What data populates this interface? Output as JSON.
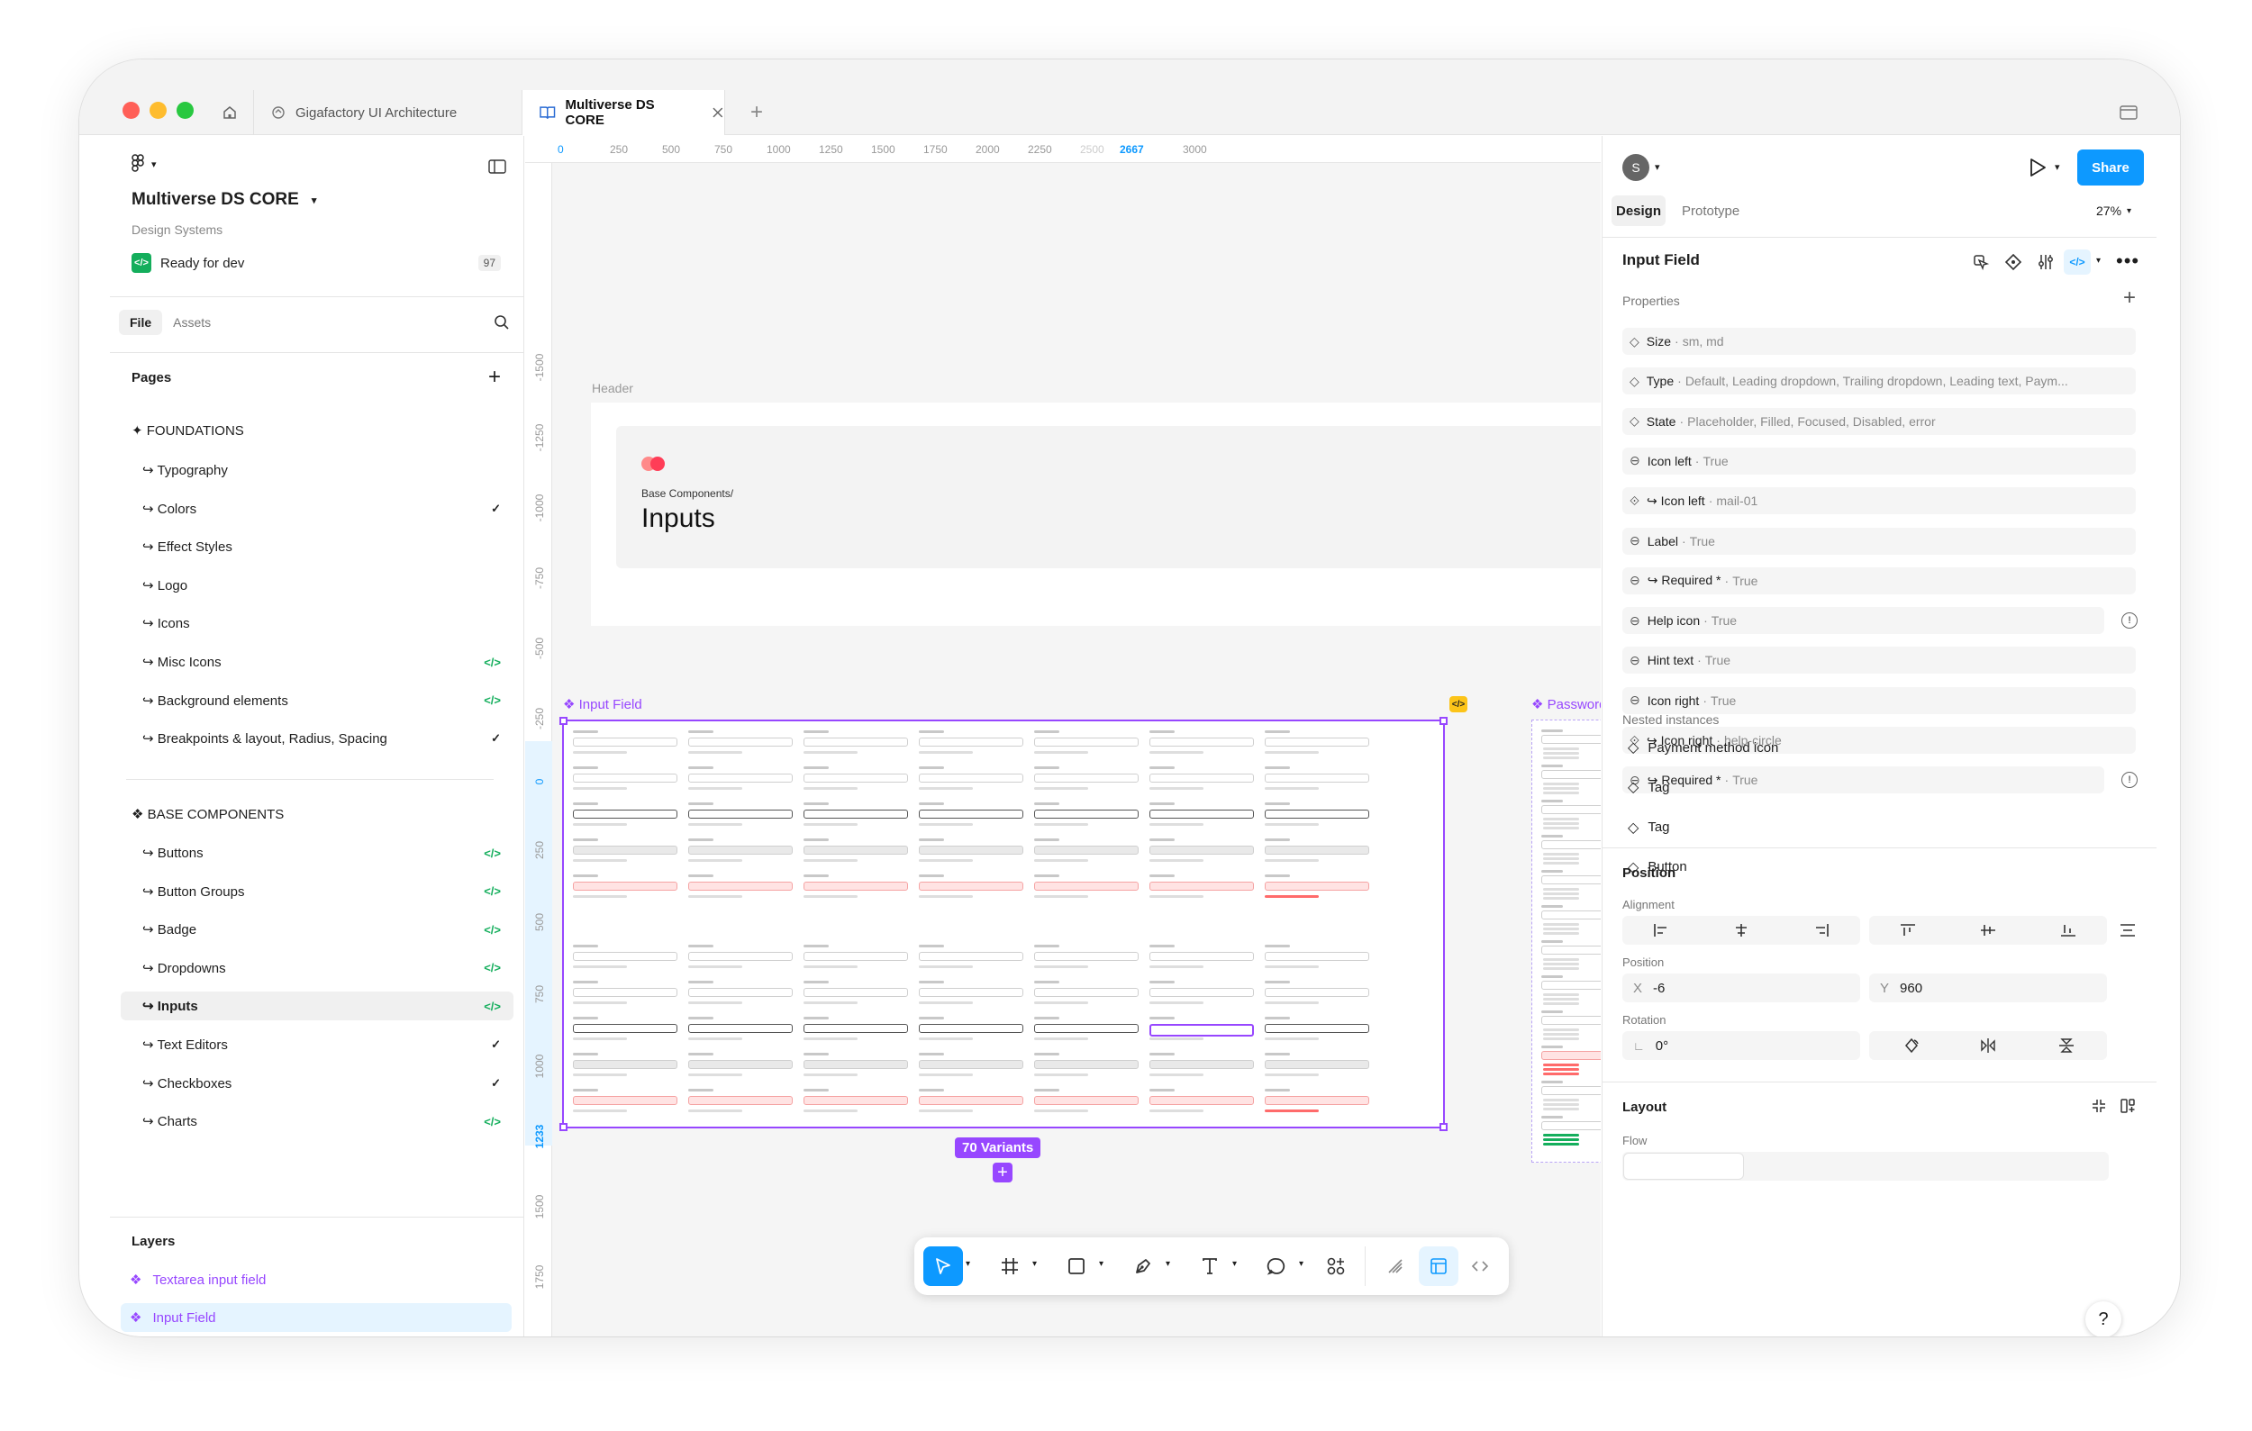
{
  "tabs": {
    "home_icon": "home-icon",
    "tab1": "Gigafactory UI Architecture",
    "tab2": "Multiverse DS CORE",
    "add": "+"
  },
  "file": {
    "name": "Multiverse DS CORE",
    "subtitle": "Design Systems",
    "status": "Ready for dev",
    "status_count": "97",
    "tab_file": "File",
    "tab_assets": "Assets"
  },
  "pages": {
    "heading": "Pages",
    "foundations_heading": "✦ FOUNDATIONS",
    "foundations": [
      {
        "label": "↪ Typography",
        "mark": ""
      },
      {
        "label": "↪ Colors",
        "mark": "✓"
      },
      {
        "label": "↪ Effect Styles",
        "mark": ""
      },
      {
        "label": "↪ Logo",
        "mark": ""
      },
      {
        "label": "↪ Icons",
        "mark": ""
      },
      {
        "label": "↪ Misc Icons",
        "mark": "</>"
      },
      {
        "label": "↪ Background elements",
        "mark": "</>"
      },
      {
        "label": "↪ Breakpoints & layout, Radius, Spacing",
        "mark": "✓"
      }
    ],
    "base_heading": "❖ BASE COMPONENTS",
    "base": [
      {
        "label": "↪ Buttons",
        "mark": "</>"
      },
      {
        "label": "↪ Button Groups",
        "mark": "</>"
      },
      {
        "label": "↪ Badge",
        "mark": "</>"
      },
      {
        "label": "↪ Dropdowns",
        "mark": "</>"
      },
      {
        "label": "↪ Inputs",
        "mark": "</>"
      },
      {
        "label": "↪ Text Editors",
        "mark": "✓"
      },
      {
        "label": "↪ Checkboxes",
        "mark": "✓"
      },
      {
        "label": "↪ Charts",
        "mark": "</>"
      }
    ]
  },
  "layers": {
    "heading": "Layers",
    "items": [
      "Textarea input field",
      "Input Field"
    ]
  },
  "ruler": {
    "top": [
      "0",
      "250",
      "500",
      "750",
      "1000",
      "1250",
      "1500",
      "1750",
      "2000",
      "2250",
      "2500",
      "2667",
      "3000"
    ],
    "left": [
      "-1500",
      "-1250",
      "-1000",
      "-750",
      "-500",
      "-250",
      "0",
      "250",
      "500",
      "750",
      "1000",
      "1233",
      "1500",
      "1750"
    ]
  },
  "canvas": {
    "header_label": "Header",
    "breadcrumb": "Base Components/",
    "heading": "Inputs",
    "frame_label": "❖ Input Field",
    "frame2_label": "❖ Password i",
    "variants_badge": "70 Variants",
    "code_badge": "</>",
    "add_badge": "+"
  },
  "right": {
    "avatar": "S",
    "share": "Share",
    "tab_design": "Design",
    "tab_prototype": "Prototype",
    "zoom": "27%",
    "component_name": "Input Field",
    "properties_heading": "Properties",
    "properties": [
      {
        "name": "Size",
        "value": "sm, md",
        "icon": "◇"
      },
      {
        "name": "Type",
        "value": "Default, Leading dropdown, Trailing dropdown, Leading text, Paym...",
        "icon": "◇"
      },
      {
        "name": "State",
        "value": "Placeholder, Filled, Focused, Disabled, error",
        "icon": "◇"
      },
      {
        "name": "Icon left",
        "value": "True",
        "icon": "⊖"
      },
      {
        "name": "↪ Icon left",
        "value": "mail-01",
        "icon": "⟐"
      },
      {
        "name": "Label",
        "value": "True",
        "icon": "⊖"
      },
      {
        "name": "↪ Required *",
        "value": "True",
        "icon": "⊖"
      },
      {
        "name": "Help icon",
        "value": "True",
        "icon": "⊖"
      },
      {
        "name": "Hint text",
        "value": "True",
        "icon": "⊖"
      },
      {
        "name": "Icon right",
        "value": "True",
        "icon": "⊖"
      },
      {
        "name": "↪ Icon right",
        "value": "help-circle",
        "icon": "⟐"
      },
      {
        "name": "↪ Required *",
        "value": "True",
        "icon": "⊖"
      }
    ],
    "nested_heading": "Nested instances",
    "nested": [
      "Payment method icon",
      "Tag",
      "Tag",
      "Button"
    ],
    "position_heading": "Position",
    "alignment_label": "Alignment",
    "position_label": "Position",
    "x_label": "X",
    "x_value": "-6",
    "y_label": "Y",
    "y_value": "960",
    "rotation_label": "Rotation",
    "rotation_value": "0°",
    "layout_heading": "Layout",
    "flow_label": "Flow",
    "help": "?"
  },
  "colors": {
    "accent": "#0d99ff",
    "purple": "#9747ff",
    "green": "#14ae5c",
    "red": "#ff5f57",
    "yellow": "#febc2e",
    "traffic_green": "#28c840"
  }
}
